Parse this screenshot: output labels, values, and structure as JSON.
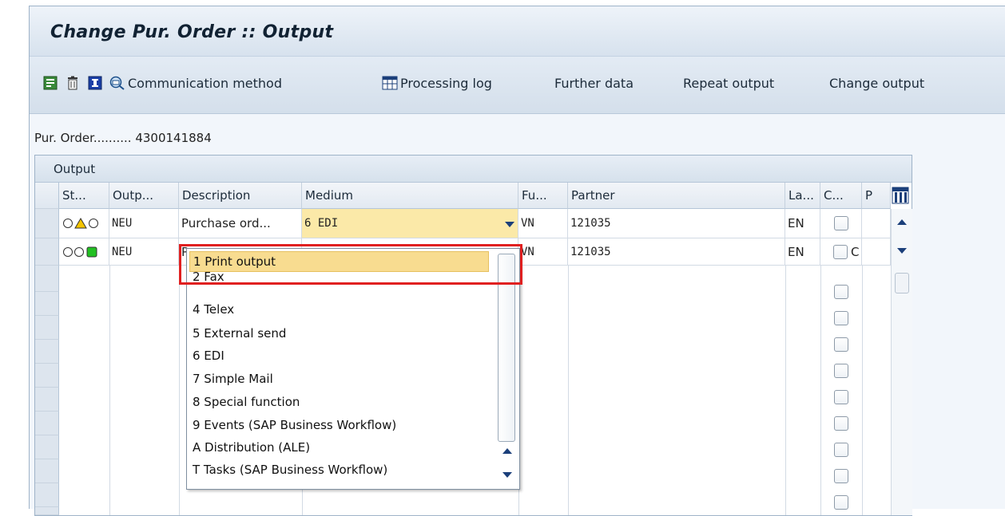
{
  "window": {
    "title": "Change Pur. Order :: Output"
  },
  "toolbar": {
    "communication_method": "Communication method",
    "processing_log": "Processing log",
    "further_data": "Further data",
    "repeat_output": "Repeat output",
    "change_output": "Change output",
    "icons": [
      "new-entries-icon",
      "delete-icon",
      "info-icon",
      "communication-icon",
      "processing-log-icon"
    ]
  },
  "header": {
    "po_label": "Pur. Order..........",
    "po_number": "4300141884"
  },
  "panel": {
    "title": "Output"
  },
  "table": {
    "columns": [
      "St...",
      "Outp...",
      "Description",
      "Medium",
      "Fu...",
      "Partner",
      "La...",
      "C...",
      "P"
    ],
    "rows": [
      {
        "status": "yellow",
        "output": "NEU",
        "description": "Purchase ord...",
        "medium": "6 EDI",
        "function": "VN",
        "partner": "121035",
        "language": "EN",
        "comm": ""
      },
      {
        "status": "green",
        "output": "NEU",
        "description": "P",
        "medium": "",
        "function": "VN",
        "partner": "121035",
        "language": "EN",
        "comm": "C"
      }
    ]
  },
  "medium_dropdown": {
    "options": [
      "1 Print output",
      "2 Fax",
      "4 Telex",
      "5 External send",
      "6 EDI",
      "7 Simple Mail",
      "8 Special function",
      "9 Events (SAP Business Workflow)",
      "A Distribution (ALE)",
      "T Tasks (SAP Business Workflow)"
    ],
    "selected": "1 Print output"
  },
  "colors": {
    "highlight": "#e02020",
    "selected_option": "#f8dc90",
    "medium_field": "#fbe9a8"
  }
}
